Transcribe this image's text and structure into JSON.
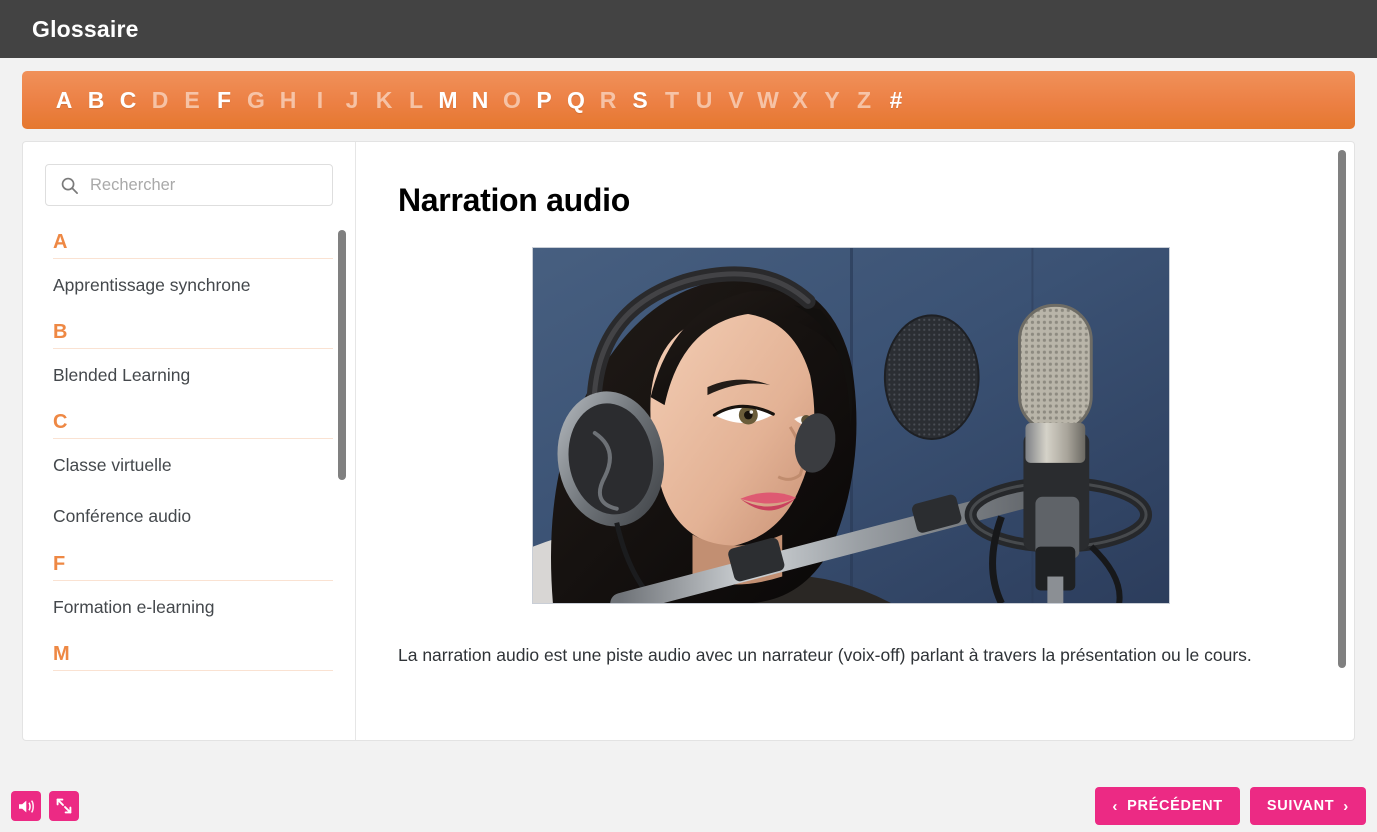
{
  "header": {
    "title": "Glossaire"
  },
  "alphabet": {
    "letters": [
      {
        "char": "A",
        "active": true
      },
      {
        "char": "B",
        "active": true
      },
      {
        "char": "C",
        "active": true
      },
      {
        "char": "D",
        "active": false
      },
      {
        "char": "E",
        "active": false
      },
      {
        "char": "F",
        "active": true
      },
      {
        "char": "G",
        "active": false
      },
      {
        "char": "H",
        "active": false
      },
      {
        "char": "I",
        "active": false
      },
      {
        "char": "J",
        "active": false
      },
      {
        "char": "K",
        "active": false
      },
      {
        "char": "L",
        "active": false
      },
      {
        "char": "M",
        "active": true
      },
      {
        "char": "N",
        "active": true
      },
      {
        "char": "O",
        "active": false
      },
      {
        "char": "P",
        "active": true
      },
      {
        "char": "Q",
        "active": true
      },
      {
        "char": "R",
        "active": false
      },
      {
        "char": "S",
        "active": true
      },
      {
        "char": "T",
        "active": false
      },
      {
        "char": "U",
        "active": false
      },
      {
        "char": "V",
        "active": false
      },
      {
        "char": "W",
        "active": false
      },
      {
        "char": "X",
        "active": false
      },
      {
        "char": "Y",
        "active": false
      },
      {
        "char": "Z",
        "active": false
      },
      {
        "char": "#",
        "active": true
      }
    ]
  },
  "search": {
    "placeholder": "Rechercher",
    "value": "",
    "icon": "search-icon"
  },
  "sidebar": {
    "groups": [
      {
        "letter": "A",
        "terms": [
          "Apprentissage synchrone"
        ]
      },
      {
        "letter": "B",
        "terms": [
          "Blended Learning"
        ]
      },
      {
        "letter": "C",
        "terms": [
          "Classe virtuelle",
          "Conférence audio"
        ]
      },
      {
        "letter": "F",
        "terms": [
          "Formation e-learning"
        ]
      },
      {
        "letter": "M",
        "terms": []
      }
    ]
  },
  "content": {
    "title": "Narration audio",
    "image_alt": "Femme avec un casque audio parlant dans un microphone de studio",
    "paragraph": "La narration audio est une piste audio avec un narrateur (voix-off) parlant à travers la présentation ou le cours."
  },
  "footer": {
    "volume_icon": "volume-icon",
    "fullscreen_icon": "fullscreen-icon",
    "prev_label": "PRÉCÉDENT",
    "next_label": "SUIVANT",
    "prev_chevron": "‹",
    "next_chevron": "›"
  },
  "colors": {
    "header_bg": "#434343",
    "alphabet_bg": "#ec8044",
    "accent_orange": "#ee8844",
    "accent_pink": "#ec2a84",
    "page_bg": "#f2f2f2",
    "scrollbar": "#808080"
  }
}
